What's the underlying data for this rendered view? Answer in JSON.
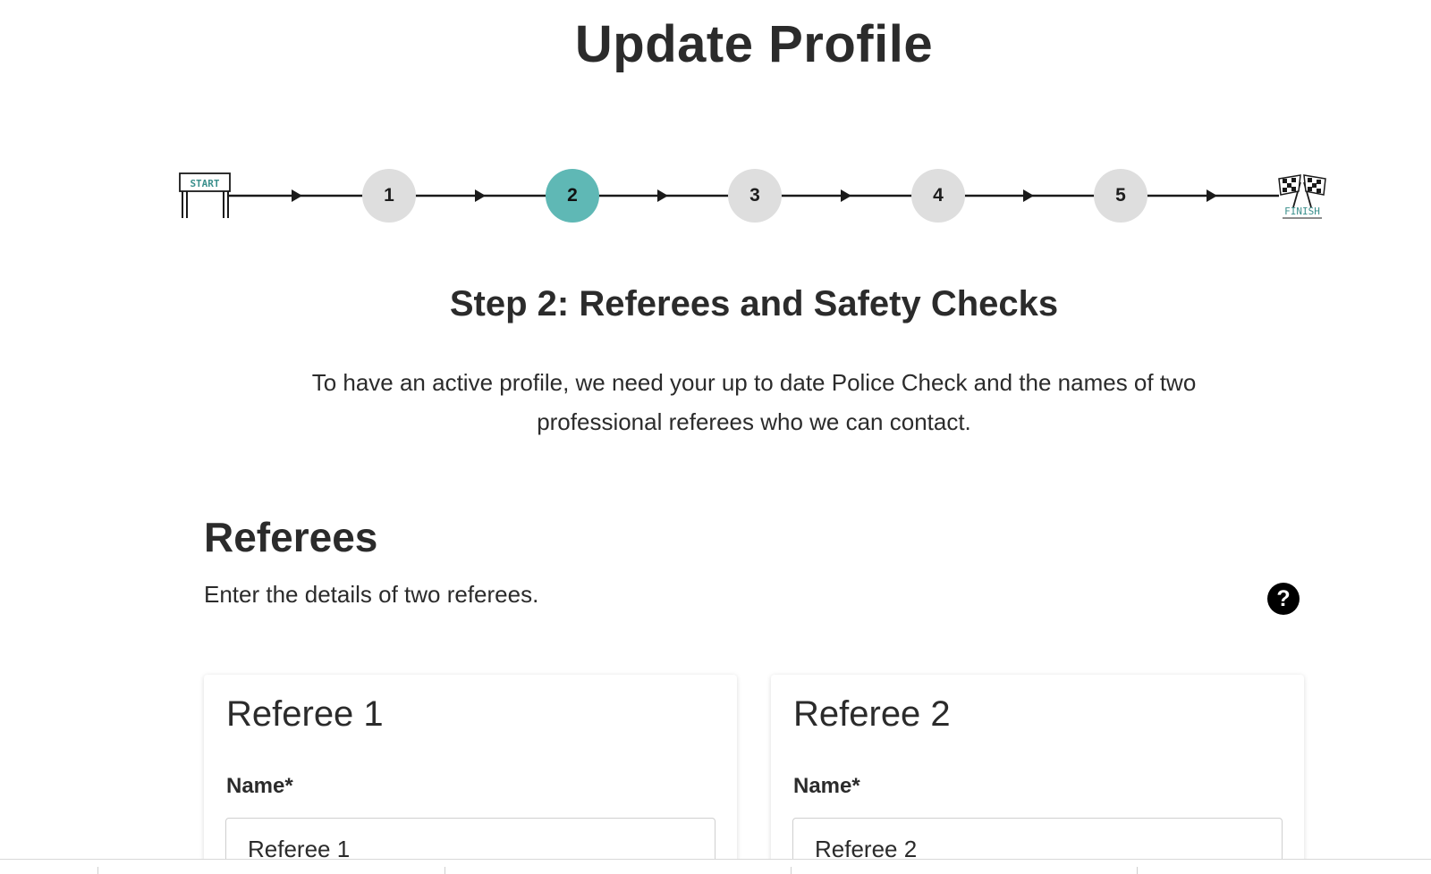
{
  "page": {
    "title": "Update Profile"
  },
  "progress": {
    "start_label": "START",
    "finish_label": "FINISH",
    "steps": [
      "1",
      "2",
      "3",
      "4",
      "5"
    ],
    "current_step": 2,
    "accent_color": "#5fb8b5",
    "inactive_color": "#dedede"
  },
  "step": {
    "heading": "Step 2: Referees and Safety Checks",
    "intro_line1": "To have an active profile, we need your up to date Police Check and the names of two",
    "intro_line2": "professional referees who we can contact."
  },
  "referees": {
    "title": "Referees",
    "subtitle": "Enter the details of two referees.",
    "help_glyph": "?",
    "help_icon": "question-circle-icon",
    "cards": [
      {
        "title": "Referee 1",
        "name_label": "Name*",
        "name_value": "Referee 1"
      },
      {
        "title": "Referee 2",
        "name_label": "Name*",
        "name_value": "Referee 2"
      }
    ]
  }
}
